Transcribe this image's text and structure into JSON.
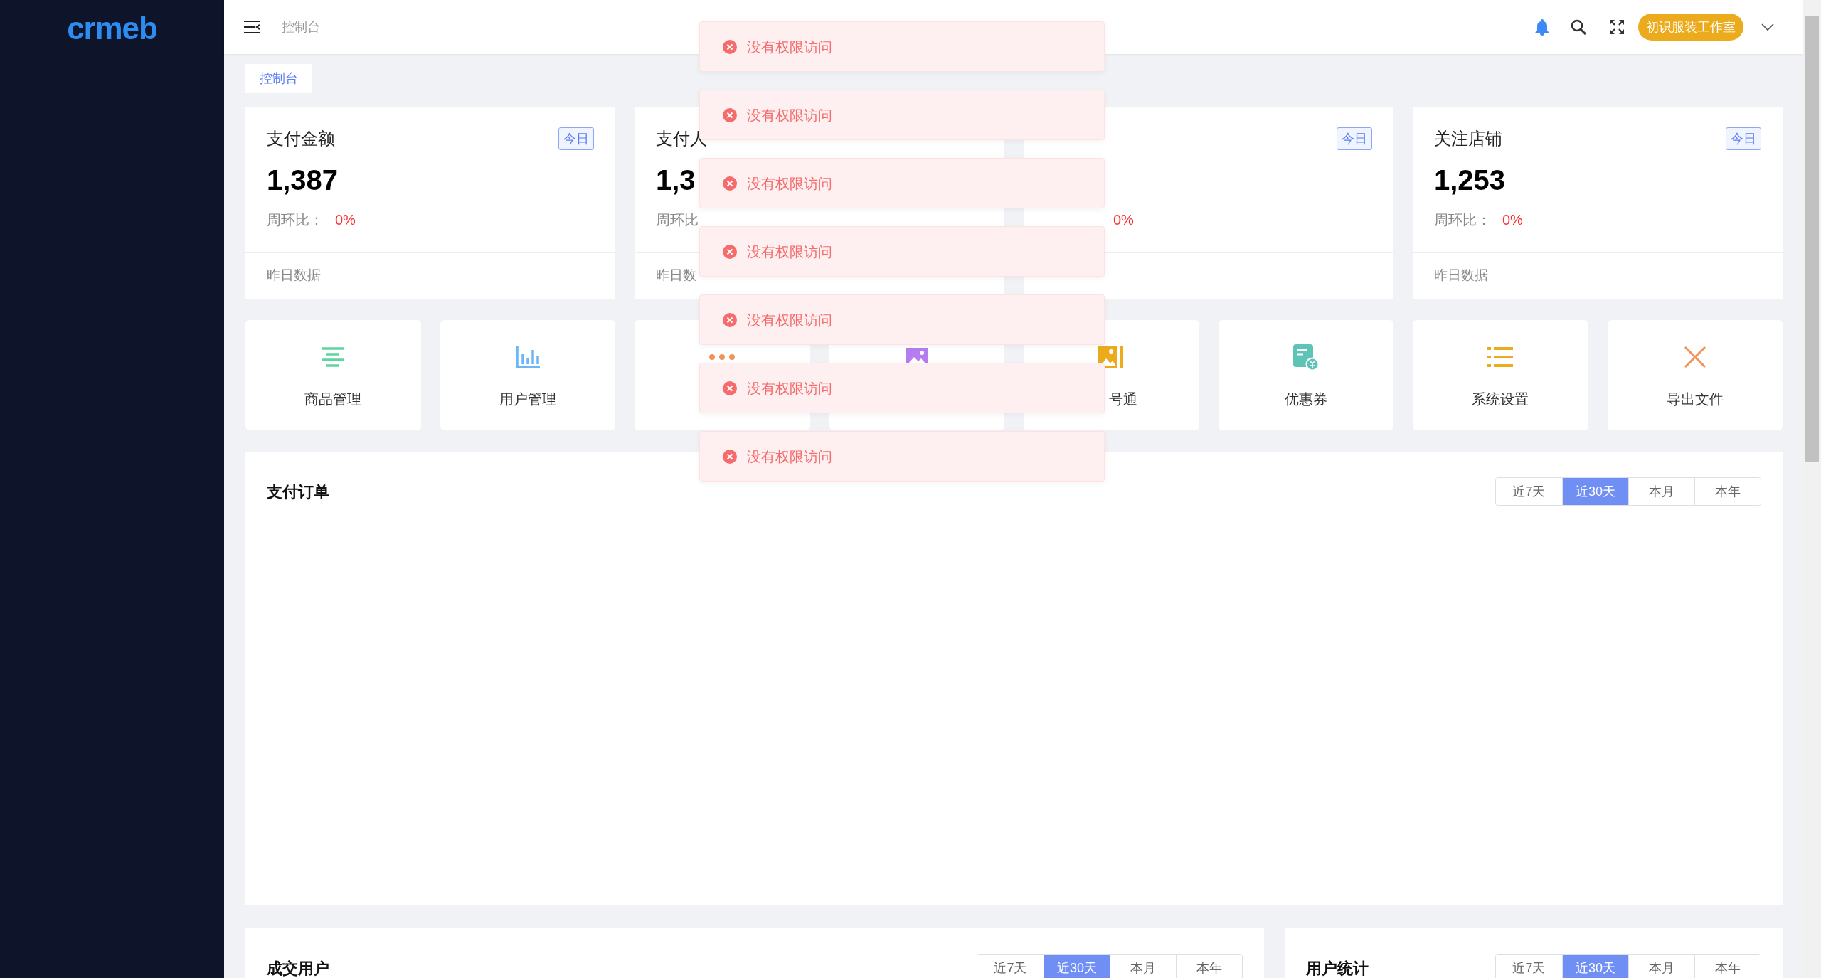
{
  "sidebar": {
    "logo": "crmeb"
  },
  "header": {
    "breadcrumb": "控制台",
    "store_button": "初识服装工作室"
  },
  "page_tag": "控制台",
  "stat_cards": [
    {
      "title": "支付金额",
      "badge": "今日",
      "number": "1,387",
      "ratio_label": "周环比：",
      "ratio": "0%",
      "footer": "昨日数据"
    },
    {
      "title": "支付人",
      "number": "1,3",
      "ratio_label": "周环比",
      "footer": "昨日数"
    },
    {
      "badge": "今日",
      "ratio": "0%"
    },
    {
      "title": "关注店铺",
      "badge": "今日",
      "number": "1,253",
      "ratio_label": "周环比：",
      "ratio": "0%",
      "footer": "昨日数据"
    }
  ],
  "shortcuts": [
    {
      "kind": "lines",
      "label": "商品管理"
    },
    {
      "kind": "bars",
      "label": "用户管理"
    },
    {
      "kind": "dots"
    },
    {
      "kind": "picture"
    },
    {
      "kind": "picture-bar",
      "label": "号通",
      "covered_start": true
    },
    {
      "kind": "coupon",
      "label": "优惠券"
    },
    {
      "kind": "list",
      "label": "系统设置"
    },
    {
      "kind": "cross",
      "label": "导出文件"
    }
  ],
  "panels": [
    {
      "title": "支付订单",
      "ranges": [
        {
          "label": "近7天",
          "selected": false
        },
        {
          "label": "近30天",
          "selected": true
        },
        {
          "label": "本月",
          "selected": false
        },
        {
          "label": "本年",
          "selected": false
        }
      ]
    },
    {
      "title": "成交用户",
      "ranges": [
        {
          "label": "近7天",
          "selected": false
        },
        {
          "label": "近30天",
          "selected": true
        },
        {
          "label": "本月",
          "selected": false
        },
        {
          "label": "本年",
          "selected": false
        }
      ]
    },
    {
      "title": "用户统计",
      "ranges": [
        {
          "label": "近7天",
          "selected": false
        },
        {
          "label": "近30天",
          "selected": true
        },
        {
          "label": "本月",
          "selected": false
        },
        {
          "label": "本年",
          "selected": false
        }
      ]
    }
  ],
  "toasts": [
    "没有权限访问",
    "没有权限访问",
    "没有权限访问",
    "没有权限访问",
    "没有权限访问",
    "没有权限访问",
    "没有权限访问"
  ]
}
